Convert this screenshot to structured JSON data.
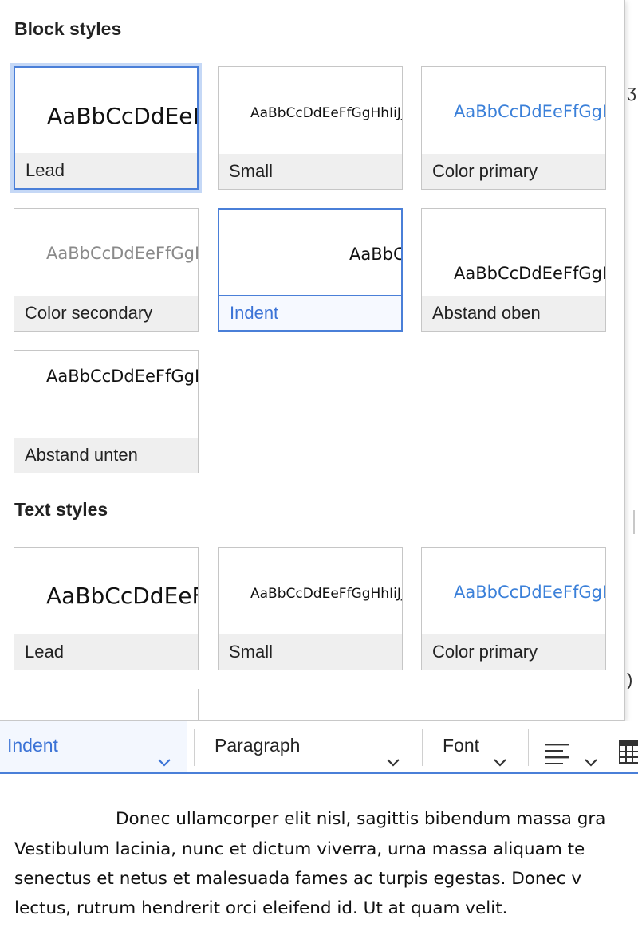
{
  "panel": {
    "block_section_title": "Block styles",
    "text_section_title": "Text styles",
    "sample_text": "AaBbCcDdEeFfGgHhIiJj",
    "colors": {
      "primary": "#3b80d9",
      "secondary": "#8a8a8a",
      "accent": "#4a7fd8"
    },
    "block_styles": [
      {
        "label": "Lead",
        "state": "focused"
      },
      {
        "label": "Small",
        "state": "normal"
      },
      {
        "label": "Color primary",
        "state": "normal"
      },
      {
        "label": "Color secondary",
        "state": "normal"
      },
      {
        "label": "Indent",
        "state": "active"
      },
      {
        "label": "Abstand oben",
        "state": "normal"
      },
      {
        "label": "Abstand unten",
        "state": "normal"
      }
    ],
    "text_styles": [
      {
        "label": "Lead",
        "state": "normal"
      },
      {
        "label": "Small",
        "state": "normal"
      },
      {
        "label": "Color primary",
        "state": "normal"
      }
    ]
  },
  "toolbar": {
    "styles_value": "Indent",
    "heading_value": "Paragraph",
    "font_label": "Font",
    "icons": [
      "chevron-down-icon",
      "align-left-icon",
      "table-icon"
    ]
  },
  "document": {
    "lines": [
      "Donec ullamcorper elit nisl, sagittis bibendum massa gra",
      "Vestibulum lacinia,  nunc et dictum viverra, urna massa aliquam te",
      "senectus et netus et  malesuada fames ac turpis egestas. Donec v",
      "lectus, rutrum hendrerit orci  eleifend id. Ut at quam velit."
    ]
  }
}
